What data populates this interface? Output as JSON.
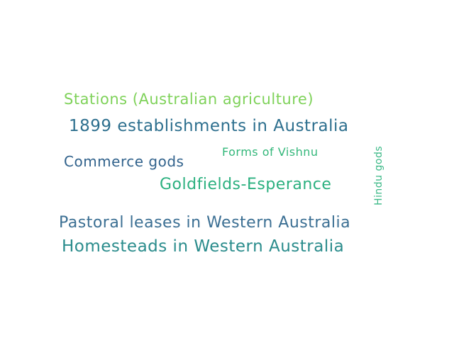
{
  "words": [
    {
      "text": "Stations (Australian agriculture)",
      "color": "#7fd25a"
    },
    {
      "text": "1899 establishments in Australia",
      "color": "#2d6f8e"
    },
    {
      "text": "Forms of Vishnu",
      "color": "#33b77a"
    },
    {
      "text": "Commerce gods",
      "color": "#31628c"
    },
    {
      "text": "Goldfields-Esperance",
      "color": "#2bb07f"
    },
    {
      "text": "Hindu gods",
      "color": "#3ab886",
      "orientation": "vertical"
    },
    {
      "text": "Pastoral leases in Western Australia",
      "color": "#3b6f93"
    },
    {
      "text": "Homesteads in Western Australia",
      "color": "#2a8c8c"
    }
  ]
}
